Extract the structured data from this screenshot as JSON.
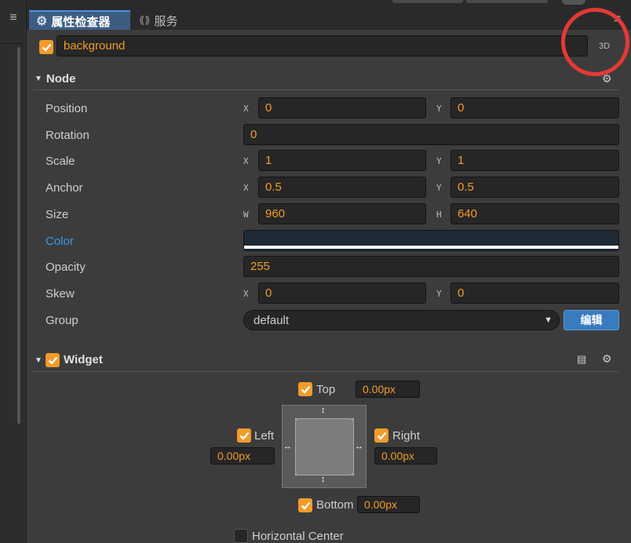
{
  "tabs": [
    {
      "label": "属性检查器"
    },
    {
      "label": "服务"
    }
  ],
  "node_name": "background",
  "mode_label": "3D",
  "node_section": {
    "title": "Node",
    "position": {
      "label": "Position",
      "x": "0",
      "y": "0"
    },
    "rotation": {
      "label": "Rotation",
      "value": "0"
    },
    "scale": {
      "label": "Scale",
      "x": "1",
      "y": "1"
    },
    "anchor": {
      "label": "Anchor",
      "x": "0.5",
      "y": "0.5"
    },
    "size": {
      "label": "Size",
      "w": "960",
      "h": "640"
    },
    "color": {
      "label": "Color",
      "swatch": "#1e2a36"
    },
    "opacity": {
      "label": "Opacity",
      "value": "255"
    },
    "skew": {
      "label": "Skew",
      "x": "0",
      "y": "0"
    },
    "group": {
      "label": "Group",
      "value": "default",
      "edit_label": "编辑"
    }
  },
  "axes": {
    "x": "X",
    "y": "Y",
    "w": "W",
    "h": "H"
  },
  "widget_section": {
    "title": "Widget",
    "top": {
      "label": "Top",
      "value": "0.00px"
    },
    "left": {
      "label": "Left",
      "value": "0.00px"
    },
    "right": {
      "label": "Right",
      "value": "0.00px"
    },
    "bottom": {
      "label": "Bottom",
      "value": "0.00px"
    },
    "horizontal_center": {
      "label": "Horizontal Center"
    }
  },
  "colors": {
    "accent": "#f29b2a",
    "link": "#3b99e8",
    "button": "#3a7bc0"
  }
}
